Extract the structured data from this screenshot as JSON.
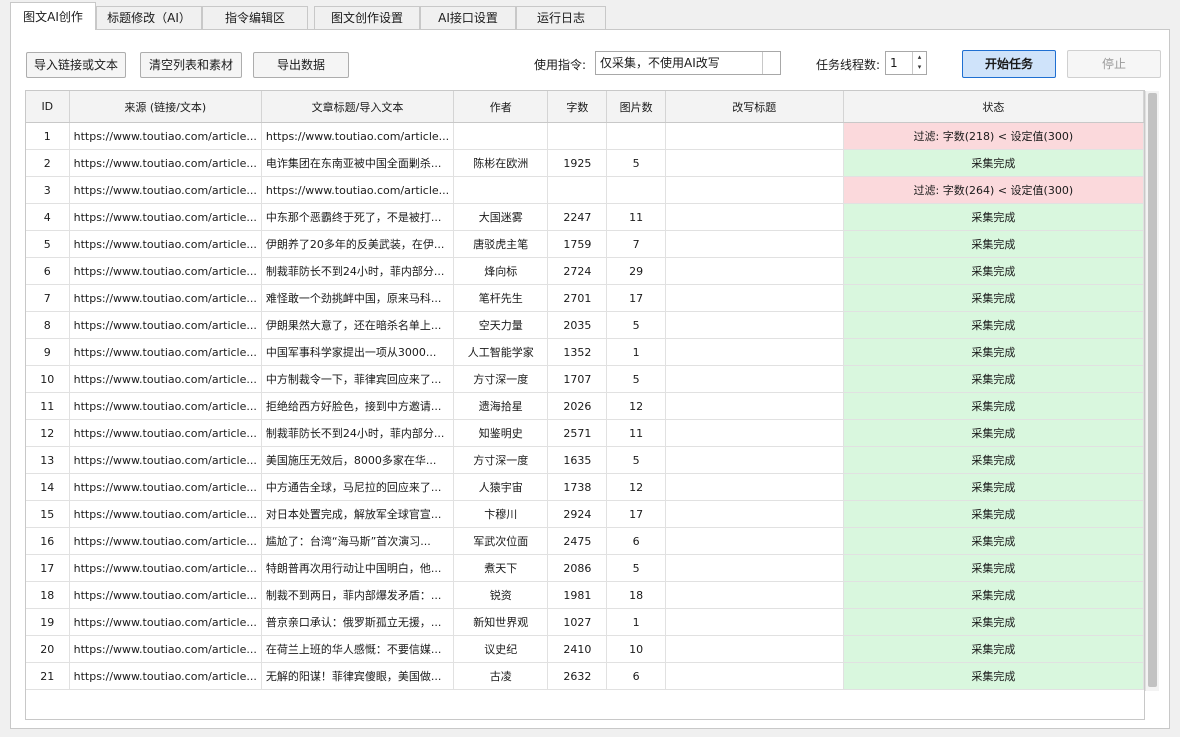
{
  "tabs": [
    {
      "label": "图文AI创作",
      "active": true
    },
    {
      "label": "标题修改（AI）",
      "active": false
    },
    {
      "label": "指令编辑区",
      "active": false
    },
    {
      "label": "图文创作设置",
      "active": false
    },
    {
      "label": "AI接口设置",
      "active": false
    },
    {
      "label": "运行日志",
      "active": false
    }
  ],
  "toolbar": {
    "import_label": "导入链接或文本",
    "clear_label": "清空列表和素材",
    "export_label": "导出数据",
    "instruction_label": "使用指令:",
    "instruction_value": "仅采集，不使用AI改写",
    "threads_label": "任务线程数:",
    "threads_value": "1",
    "start_label": "开始任务",
    "stop_label": "停止"
  },
  "table": {
    "columns": [
      "ID",
      "来源 (链接/文本)",
      "文章标题/导入文本",
      "作者",
      "字数",
      "图片数",
      "改写标题",
      "状态"
    ],
    "rows": [
      {
        "id": "1",
        "src": "https://www.toutiao.com/article...",
        "title": "https://www.toutiao.com/article...",
        "author": "",
        "words": "",
        "imgs": "",
        "rewrite": "",
        "status": "过滤: 字数(218) < 设定值(300)",
        "state": "filter"
      },
      {
        "id": "2",
        "src": "https://www.toutiao.com/article...",
        "title": "电诈集团在东南亚被中国全面剿杀...",
        "author": "陈彬在欧洲",
        "words": "1925",
        "imgs": "5",
        "rewrite": "",
        "status": "采集完成",
        "state": "ok"
      },
      {
        "id": "3",
        "src": "https://www.toutiao.com/article...",
        "title": "https://www.toutiao.com/article...",
        "author": "",
        "words": "",
        "imgs": "",
        "rewrite": "",
        "status": "过滤: 字数(264) < 设定值(300)",
        "state": "filter"
      },
      {
        "id": "4",
        "src": "https://www.toutiao.com/article...",
        "title": "中东那个恶霸终于死了，不是被打...",
        "author": "大国迷雾",
        "words": "2247",
        "imgs": "11",
        "rewrite": "",
        "status": "采集完成",
        "state": "ok"
      },
      {
        "id": "5",
        "src": "https://www.toutiao.com/article...",
        "title": "伊朗养了20多年的反美武装，在伊...",
        "author": "唐驳虎主笔",
        "words": "1759",
        "imgs": "7",
        "rewrite": "",
        "status": "采集完成",
        "state": "ok"
      },
      {
        "id": "6",
        "src": "https://www.toutiao.com/article...",
        "title": "制裁菲防长不到24小时，菲内部分...",
        "author": "烽向标",
        "words": "2724",
        "imgs": "29",
        "rewrite": "",
        "status": "采集完成",
        "state": "ok"
      },
      {
        "id": "7",
        "src": "https://www.toutiao.com/article...",
        "title": "难怪敢一个劲挑衅中国，原来马科...",
        "author": "笔杆先生",
        "words": "2701",
        "imgs": "17",
        "rewrite": "",
        "status": "采集完成",
        "state": "ok"
      },
      {
        "id": "8",
        "src": "https://www.toutiao.com/article...",
        "title": "伊朗果然大意了，还在暗杀名单上...",
        "author": "空天力量",
        "words": "2035",
        "imgs": "5",
        "rewrite": "",
        "status": "采集完成",
        "state": "ok"
      },
      {
        "id": "9",
        "src": "https://www.toutiao.com/article...",
        "title": "中国军事科学家提出一项从3000...",
        "author": "人工智能学家",
        "words": "1352",
        "imgs": "1",
        "rewrite": "",
        "status": "采集完成",
        "state": "ok"
      },
      {
        "id": "10",
        "src": "https://www.toutiao.com/article...",
        "title": "中方制裁令一下，菲律宾回应来了...",
        "author": "方寸深一度",
        "words": "1707",
        "imgs": "5",
        "rewrite": "",
        "status": "采集完成",
        "state": "ok"
      },
      {
        "id": "11",
        "src": "https://www.toutiao.com/article...",
        "title": "拒绝给西方好脸色，接到中方邀请...",
        "author": "遗海拾星",
        "words": "2026",
        "imgs": "12",
        "rewrite": "",
        "status": "采集完成",
        "state": "ok"
      },
      {
        "id": "12",
        "src": "https://www.toutiao.com/article...",
        "title": "制裁菲防长不到24小时，菲内部分...",
        "author": "知鉴明史",
        "words": "2571",
        "imgs": "11",
        "rewrite": "",
        "status": "采集完成",
        "state": "ok"
      },
      {
        "id": "13",
        "src": "https://www.toutiao.com/article...",
        "title": "美国施压无效后，8000多家在华...",
        "author": "方寸深一度",
        "words": "1635",
        "imgs": "5",
        "rewrite": "",
        "status": "采集完成",
        "state": "ok"
      },
      {
        "id": "14",
        "src": "https://www.toutiao.com/article...",
        "title": "中方通告全球，马尼拉的回应来了...",
        "author": "人猿宇宙",
        "words": "1738",
        "imgs": "12",
        "rewrite": "",
        "status": "采集完成",
        "state": "ok"
      },
      {
        "id": "15",
        "src": "https://www.toutiao.com/article...",
        "title": "对日本处置完成，解放军全球官宣...",
        "author": "卞穆川",
        "words": "2924",
        "imgs": "17",
        "rewrite": "",
        "status": "采集完成",
        "state": "ok"
      },
      {
        "id": "16",
        "src": "https://www.toutiao.com/article...",
        "title": "尴尬了：台湾“海马斯”首次演习...",
        "author": "军武次位面",
        "words": "2475",
        "imgs": "6",
        "rewrite": "",
        "status": "采集完成",
        "state": "ok"
      },
      {
        "id": "17",
        "src": "https://www.toutiao.com/article...",
        "title": "特朗普再次用行动让中国明白，他...",
        "author": "煮天下",
        "words": "2086",
        "imgs": "5",
        "rewrite": "",
        "status": "采集完成",
        "state": "ok"
      },
      {
        "id": "18",
        "src": "https://www.toutiao.com/article...",
        "title": "制裁不到两日，菲内部爆发矛盾：...",
        "author": "锐资",
        "words": "1981",
        "imgs": "18",
        "rewrite": "",
        "status": "采集完成",
        "state": "ok"
      },
      {
        "id": "19",
        "src": "https://www.toutiao.com/article...",
        "title": "普京亲口承认：俄罗斯孤立无援，...",
        "author": "新知世界观",
        "words": "1027",
        "imgs": "1",
        "rewrite": "",
        "status": "采集完成",
        "state": "ok"
      },
      {
        "id": "20",
        "src": "https://www.toutiao.com/article...",
        "title": "在荷兰上班的华人感慨：不要信媒...",
        "author": "议史纪",
        "words": "2410",
        "imgs": "10",
        "rewrite": "",
        "status": "采集完成",
        "state": "ok"
      },
      {
        "id": "21",
        "src": "https://www.toutiao.com/article...",
        "title": "无解的阳谋！菲律宾傻眼，美国做...",
        "author": "古凌",
        "words": "2632",
        "imgs": "6",
        "rewrite": "",
        "status": "采集完成",
        "state": "ok"
      }
    ]
  },
  "colors": {
    "ok": "#d9f7de",
    "filter": "#fbd9dc",
    "primary_border": "#1f6fd1"
  }
}
